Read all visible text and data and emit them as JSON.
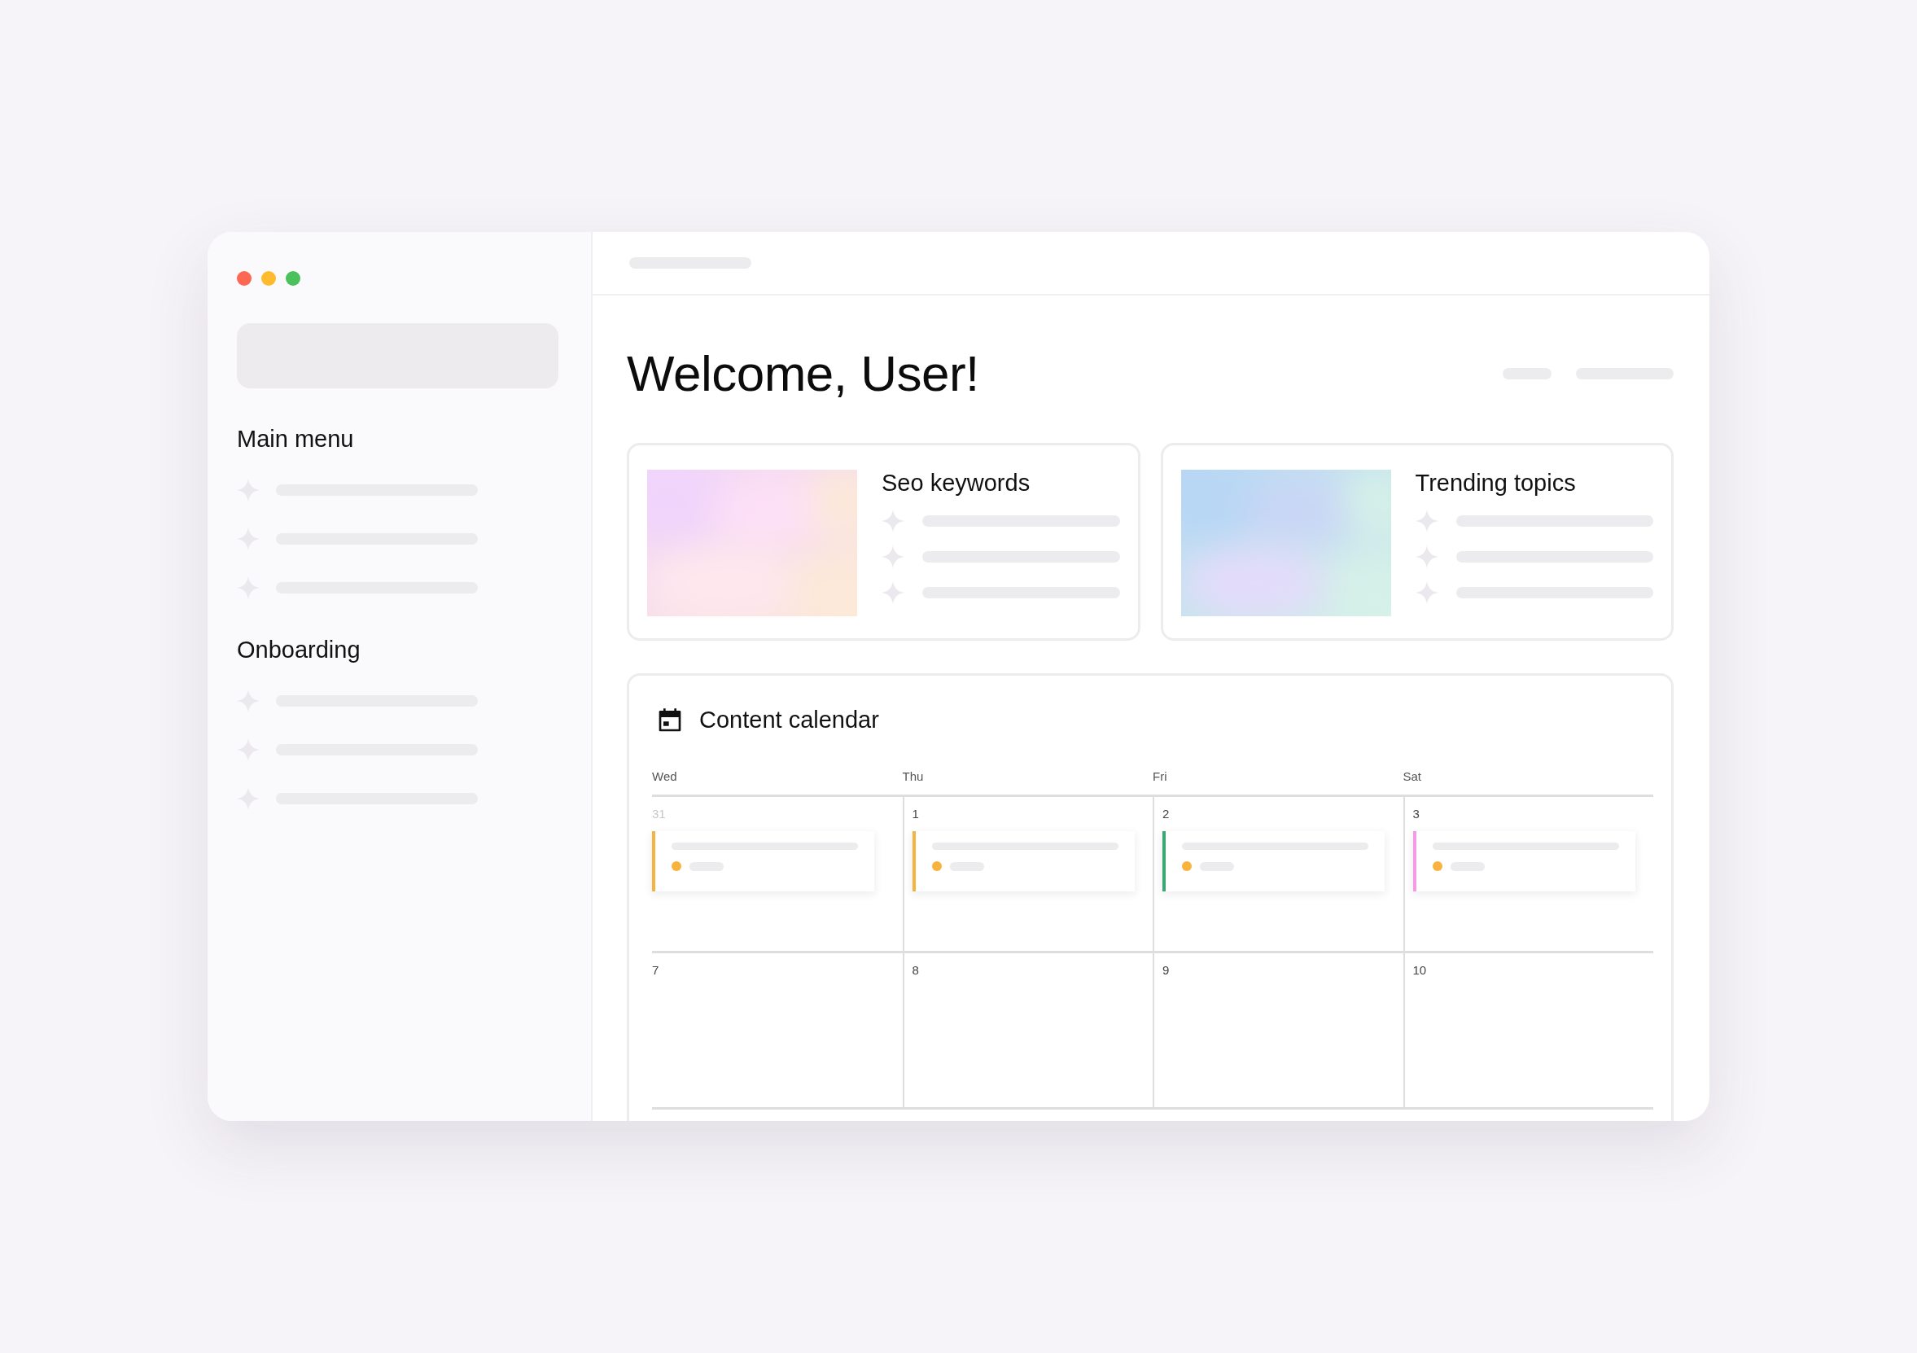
{
  "sidebar": {
    "sections": [
      {
        "title": "Main menu"
      },
      {
        "title": "Onboarding"
      }
    ]
  },
  "main": {
    "heading": "Welcome, User!",
    "cards": [
      {
        "title": "Seo keywords"
      },
      {
        "title": "Trending topics"
      }
    ],
    "calendar": {
      "title": "Content calendar",
      "days": [
        "Wed",
        "Thu",
        "Fri",
        "Sat"
      ],
      "weeks": [
        [
          {
            "date": "31",
            "outside_month": true,
            "event": {
              "color": "#f5b342"
            }
          },
          {
            "date": "1",
            "outside_month": false,
            "event": {
              "color": "#f5b342"
            }
          },
          {
            "date": "2",
            "outside_month": false,
            "event": {
              "color": "#3aa872"
            }
          },
          {
            "date": "3",
            "outside_month": false,
            "event": {
              "color": "#f49be8"
            }
          }
        ],
        [
          {
            "date": "7",
            "outside_month": false
          },
          {
            "date": "8",
            "outside_month": false
          },
          {
            "date": "9",
            "outside_month": false
          },
          {
            "date": "10",
            "outside_month": false
          }
        ]
      ]
    }
  }
}
